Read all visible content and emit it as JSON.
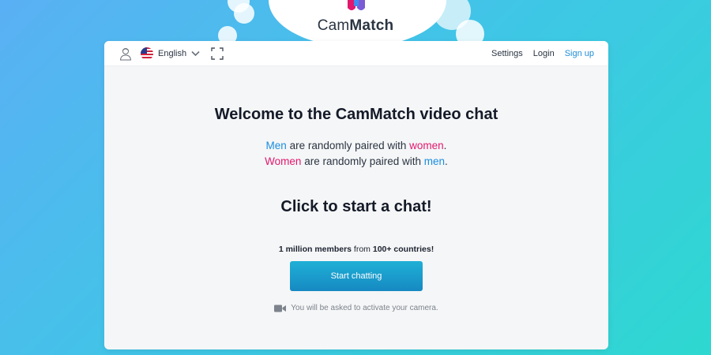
{
  "brand": {
    "name_light": "Cam",
    "name_bold": "Match"
  },
  "topbar": {
    "language": "English",
    "links": {
      "settings": "Settings",
      "login": "Login",
      "signup": "Sign up"
    }
  },
  "main": {
    "title": "Welcome to the CamMatch video chat",
    "line1": {
      "a": "Men",
      "b": " are randomly paired with ",
      "c": "women",
      "d": "."
    },
    "line2": {
      "a": "Women",
      "b": " are randomly paired with ",
      "c": "men",
      "d": "."
    },
    "cta_heading": "Click to start a chat!",
    "members": {
      "a": "1 million members",
      "b": " from ",
      "c": "100+ countries!"
    },
    "start_button": "Start chatting",
    "camera_note": "You will be asked to activate your camera."
  },
  "colors": {
    "accent_blue": "#1a8de0",
    "accent_pink": "#e2186f"
  }
}
